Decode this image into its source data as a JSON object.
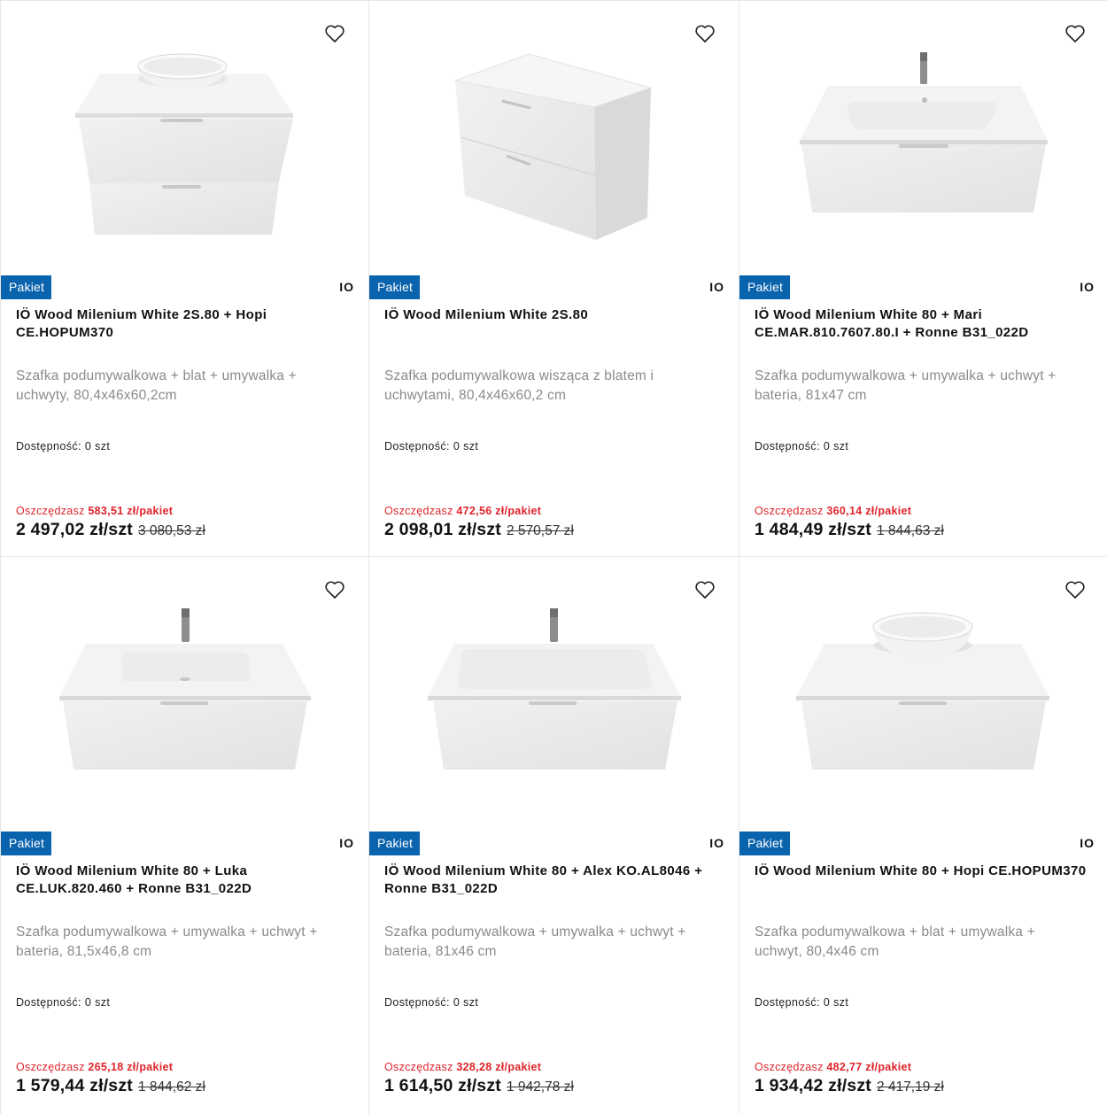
{
  "badge_label": "Pakiet",
  "brand_label": "IO",
  "availability_label": "Dostępność:",
  "savings_prefix": "Oszczędzasz",
  "products": [
    {
      "title": "IÖ Wood Milenium White 2S.80 + Hopi CE.HOPUM370",
      "description": "Szafka podumywalkowa + blat + umywalka + uchwyty, 80,4x46x60,2cm",
      "availability": "0 szt",
      "savings": "583,51 zł/pakiet",
      "price": "2 497,02 zł/szt",
      "old_price": "3 080,53 zł",
      "image": "cabinet-2-drawers-bowl-basin"
    },
    {
      "title": "IÖ Wood Milenium White 2S.80",
      "description": "Szafka podumywalkowa wisząca z blatem i uchwytami, 80,4x46x60,2 cm",
      "availability": "0 szt",
      "savings": "472,56 zł/pakiet",
      "price": "2 098,01 zł/szt",
      "old_price": "2 570,57 zł",
      "image": "cabinet-2-drawers-perspective"
    },
    {
      "title": "IÖ Wood Milenium White 80 + Mari CE.MAR.810.7607.80.I + Ronne B31_022D",
      "description": "Szafka podumywalkowa + umywalka + uchwyt + bateria, 81x47 cm",
      "availability": "0 szt",
      "savings": "360,14 zł/pakiet",
      "price": "1 484,49 zł/szt",
      "old_price": "1 844,63 zł",
      "image": "cabinet-1-drawer-integrated-basin"
    },
    {
      "title": "IÖ Wood Milenium White 80 + Luka CE.LUK.820.460 + Ronne B31_022D",
      "description": "Szafka podumywalkowa + umywalka + uchwyt + bateria, 81,5x46,8 cm",
      "availability": "0 szt",
      "savings": "265,18 zł/pakiet",
      "price": "1 579,44 zł/szt",
      "old_price": "1 844,62 zł",
      "image": "cabinet-1-drawer-integrated-basin"
    },
    {
      "title": "IÖ Wood Milenium White 80 + Alex KO.AL8046 + Ronne B31_022D",
      "description": "Szafka podumywalkowa + umywalka + uchwyt + bateria, 81x46 cm",
      "availability": "0 szt",
      "savings": "328,28 zł/pakiet",
      "price": "1 614,50 zł/szt",
      "old_price": "1 942,78 zł",
      "image": "cabinet-1-drawer-integrated-basin"
    },
    {
      "title": "IÖ Wood Milenium White 80 + Hopi CE.HOPUM370",
      "description": "Szafka podumywalkowa + blat + umywalka + uchwyt, 80,4x46 cm",
      "availability": "0 szt",
      "savings": "482,77 zł/pakiet",
      "price": "1 934,42 zł/szt",
      "old_price": "2 417,19 zł",
      "image": "cabinet-1-drawer-bowl-basin"
    }
  ],
  "colors": {
    "badge": "#0a63ad",
    "savings": "#e0242b",
    "description": "#8a8a8a"
  }
}
